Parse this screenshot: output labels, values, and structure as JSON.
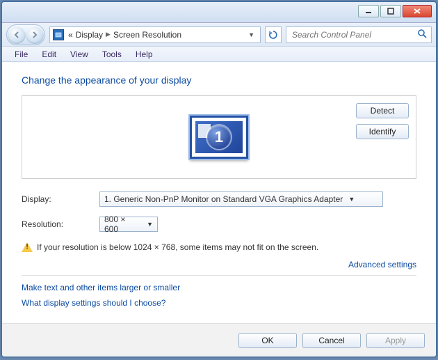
{
  "address": {
    "seg1_prefix": "«",
    "seg1": "Display",
    "seg2": "Screen Resolution"
  },
  "search": {
    "placeholder": "Search Control Panel"
  },
  "menu": {
    "file": "File",
    "edit": "Edit",
    "view": "View",
    "tools": "Tools",
    "help": "Help"
  },
  "title": "Change the appearance of your display",
  "monitor": {
    "number": "1"
  },
  "buttons": {
    "detect": "Detect",
    "identify": "Identify",
    "ok": "OK",
    "cancel": "Cancel",
    "apply": "Apply"
  },
  "labels": {
    "display": "Display:",
    "resolution": "Resolution:"
  },
  "dropdowns": {
    "display_value": "1. Generic Non-PnP Monitor on Standard VGA Graphics Adapter",
    "resolution_value": "800 × 600"
  },
  "warning": "If your resolution is below 1024 × 768, some items may not fit on the screen.",
  "links": {
    "advanced": "Advanced settings",
    "text_size": "Make text and other items larger or smaller",
    "help": "What display settings should I choose?"
  }
}
